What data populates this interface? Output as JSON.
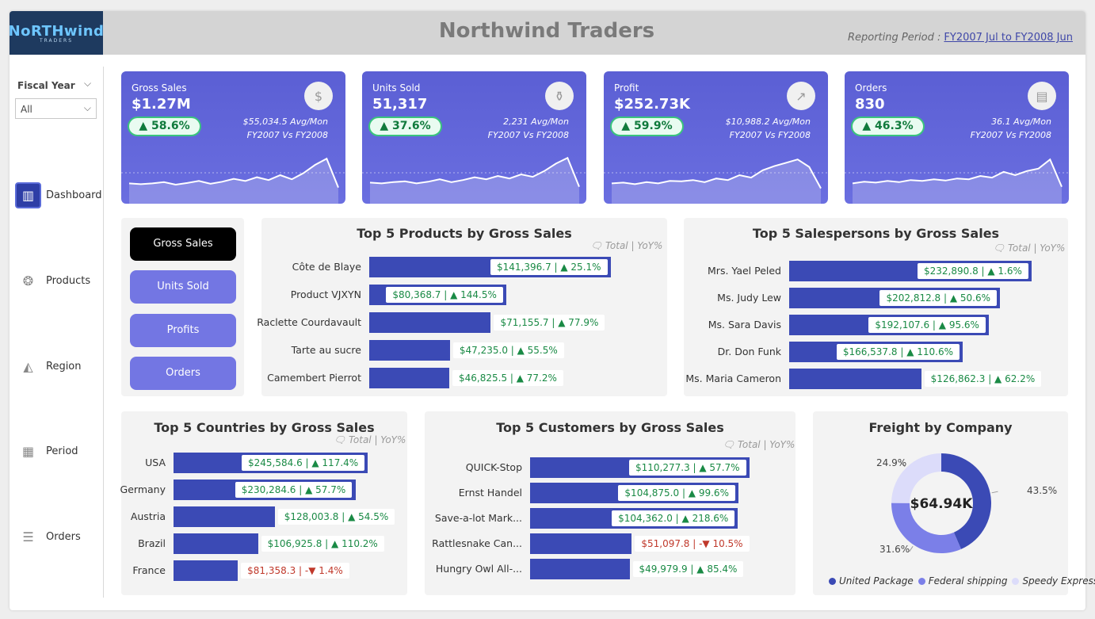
{
  "header": {
    "logo_main": "NoRTHwind",
    "logo_sub": "TRADERS",
    "title": "Northwind Traders",
    "period_label": "Reporting Period :",
    "period_value": "FY2007 Jul to FY2008 Jun"
  },
  "filter": {
    "label": "Fiscal Year",
    "value": "All"
  },
  "nav": [
    {
      "label": "Dashboard",
      "icon": "dashboard-icon"
    },
    {
      "label": "Products",
      "icon": "products-icon"
    },
    {
      "label": "Region",
      "icon": "region-map-icon"
    },
    {
      "label": "Period",
      "icon": "calendar-icon"
    },
    {
      "label": "Orders",
      "icon": "database-icon"
    }
  ],
  "kpis": [
    {
      "label": "Gross Sales",
      "value": "$1.27M",
      "change": "▲ 58.6%",
      "avg": "$55,034.5 Avg/Mon",
      "compare": "FY2007 Vs FY2008",
      "icon": "money-hand-icon",
      "spark": [
        0.3,
        0.28,
        0.3,
        0.33,
        0.27,
        0.31,
        0.36,
        0.29,
        0.34,
        0.41,
        0.36,
        0.45,
        0.38,
        0.5,
        0.4,
        0.55,
        0.75,
        0.9,
        0.2
      ]
    },
    {
      "label": "Units Sold",
      "value": "51,317",
      "change": "▲ 37.6%",
      "avg": "2,231 Avg/Mon",
      "compare": "FY2007 Vs FY2008",
      "icon": "jar-icon",
      "spark": [
        0.32,
        0.3,
        0.33,
        0.35,
        0.3,
        0.34,
        0.4,
        0.33,
        0.38,
        0.45,
        0.4,
        0.48,
        0.42,
        0.52,
        0.46,
        0.6,
        0.78,
        0.92,
        0.22
      ]
    },
    {
      "label": "Profit",
      "value": "$252.73K",
      "change": "▲ 59.9%",
      "avg": "$10,988.2 Avg/Mon",
      "compare": "FY2007 Vs FY2008",
      "icon": "chart-up-icon",
      "spark": [
        0.3,
        0.32,
        0.28,
        0.33,
        0.3,
        0.36,
        0.35,
        0.38,
        0.33,
        0.42,
        0.38,
        0.5,
        0.44,
        0.62,
        0.72,
        0.8,
        0.88,
        0.7,
        0.18
      ]
    },
    {
      "label": "Orders",
      "value": "830",
      "change": "▲ 46.3%",
      "avg": "36.1 Avg/Mon",
      "compare": "FY2007 Vs FY2008",
      "icon": "invoice-icon",
      "spark": [
        0.3,
        0.34,
        0.32,
        0.36,
        0.33,
        0.38,
        0.36,
        0.4,
        0.37,
        0.42,
        0.4,
        0.48,
        0.44,
        0.58,
        0.5,
        0.6,
        0.66,
        0.88,
        0.22
      ]
    }
  ],
  "metric_buttons": [
    "Gross Sales",
    "Units Sold",
    "Profits",
    "Orders"
  ],
  "legend_text": "Total | YoY%",
  "products": {
    "title": "Top 5 Products by Gross Sales",
    "rows": [
      {
        "name": "Côte de Blaye",
        "value": 141396.7,
        "label": "$141,396.7 | ▲ 25.1%",
        "neg": false
      },
      {
        "name": "Product VJXYN",
        "value": 80368.7,
        "label": "$80,368.7 | ▲ 144.5%",
        "neg": false
      },
      {
        "name": "Raclette Courdavault",
        "value": 71155.7,
        "label": "$71,155.7 | ▲ 77.9%",
        "neg": false
      },
      {
        "name": "Tarte au sucre",
        "value": 47235.0,
        "label": "$47,235.0 | ▲ 55.5%",
        "neg": false
      },
      {
        "name": "Camembert Pierrot",
        "value": 46825.5,
        "label": "$46,825.5 | ▲ 77.2%",
        "neg": false
      }
    ]
  },
  "salespersons": {
    "title": "Top 5 Salespersons by Gross Sales",
    "rows": [
      {
        "name": "Mrs. Yael Peled",
        "value": 232890.8,
        "label": "$232,890.8 | ▲ 1.6%",
        "neg": false
      },
      {
        "name": "Ms. Judy Lew",
        "value": 202812.8,
        "label": "$202,812.8 | ▲ 50.6%",
        "neg": false
      },
      {
        "name": "Ms. Sara Davis",
        "value": 192107.6,
        "label": "$192,107.6 | ▲ 95.6%",
        "neg": false
      },
      {
        "name": "Dr. Don Funk",
        "value": 166537.8,
        "label": "$166,537.8 | ▲ 110.6%",
        "neg": false
      },
      {
        "name": "Ms. Maria Cameron",
        "value": 126862.3,
        "label": "$126,862.3 | ▲ 62.2%",
        "neg": false
      }
    ]
  },
  "countries": {
    "title": "Top 5 Countries by Gross Sales",
    "rows": [
      {
        "name": "USA",
        "value": 245584.6,
        "label": "$245,584.6 | ▲ 117.4%",
        "neg": false
      },
      {
        "name": "Germany",
        "value": 230284.6,
        "label": "$230,284.6 | ▲ 57.7%",
        "neg": false
      },
      {
        "name": "Austria",
        "value": 128003.8,
        "label": "$128,003.8 | ▲ 54.5%",
        "neg": false
      },
      {
        "name": "Brazil",
        "value": 106925.8,
        "label": "$106,925.8 | ▲ 110.2%",
        "neg": false
      },
      {
        "name": "France",
        "value": 81358.3,
        "label": "$81,358.3 | -▼ 1.4%",
        "neg": true
      }
    ]
  },
  "customers": {
    "title": "Top 5 Customers by Gross Sales",
    "rows": [
      {
        "name": "QUICK-Stop",
        "value": 110277.3,
        "label": "$110,277.3 | ▲ 57.7%",
        "neg": false
      },
      {
        "name": "Ernst Handel",
        "value": 104875.0,
        "label": "$104,875.0 | ▲ 99.6%",
        "neg": false
      },
      {
        "name": "Save-a-lot Mark...",
        "value": 104362.0,
        "label": "$104,362.0 | ▲ 218.6%",
        "neg": false
      },
      {
        "name": "Rattlesnake Can...",
        "value": 51097.8,
        "label": "$51,097.8 | -▼ 10.5%",
        "neg": true
      },
      {
        "name": "Hungry Owl All-...",
        "value": 49979.9,
        "label": "$49,979.9 | ▲ 85.4%",
        "neg": false
      }
    ]
  },
  "freight": {
    "title": "Freight by Company",
    "center": "$64.94K",
    "slices": [
      {
        "name": "United Package",
        "pct": 43.5,
        "label": "43.5%",
        "color": "#3b4ab5"
      },
      {
        "name": "Federal shipping",
        "pct": 31.6,
        "label": "31.6%",
        "color": "#7b7fe8"
      },
      {
        "name": "Speedy Express",
        "pct": 24.9,
        "label": "24.9%",
        "color": "#dcdcfa"
      }
    ]
  },
  "colors": {
    "bar": "#3b4ab5",
    "kpi": "#5b5fd4",
    "positive": "#1a8a45",
    "negative": "#c0392b"
  },
  "chart_data": [
    {
      "type": "bar",
      "title": "Top 5 Products by Gross Sales",
      "categories": [
        "Côte de Blaye",
        "Product VJXYN",
        "Raclette Courdavault",
        "Tarte au sucre",
        "Camembert Pierrot"
      ],
      "values": [
        141396.7,
        80368.7,
        71155.7,
        47235.0,
        46825.5
      ]
    },
    {
      "type": "bar",
      "title": "Top 5 Salespersons by Gross Sales",
      "categories": [
        "Mrs. Yael Peled",
        "Ms. Judy Lew",
        "Ms. Sara Davis",
        "Dr. Don Funk",
        "Ms. Maria Cameron"
      ],
      "values": [
        232890.8,
        202812.8,
        192107.6,
        166537.8,
        126862.3
      ]
    },
    {
      "type": "bar",
      "title": "Top 5 Countries by Gross Sales",
      "categories": [
        "USA",
        "Germany",
        "Austria",
        "Brazil",
        "France"
      ],
      "values": [
        245584.6,
        230284.6,
        128003.8,
        106925.8,
        81358.3
      ]
    },
    {
      "type": "bar",
      "title": "Top 5 Customers by Gross Sales",
      "categories": [
        "QUICK-Stop",
        "Ernst Handel",
        "Save-a-lot Mark...",
        "Rattlesnake Can...",
        "Hungry Owl All-..."
      ],
      "values": [
        110277.3,
        104875.0,
        104362.0,
        51097.8,
        49979.9
      ]
    },
    {
      "type": "pie",
      "title": "Freight by Company",
      "categories": [
        "United Package",
        "Federal shipping",
        "Speedy Express"
      ],
      "values": [
        43.5,
        31.6,
        24.9
      ]
    }
  ]
}
